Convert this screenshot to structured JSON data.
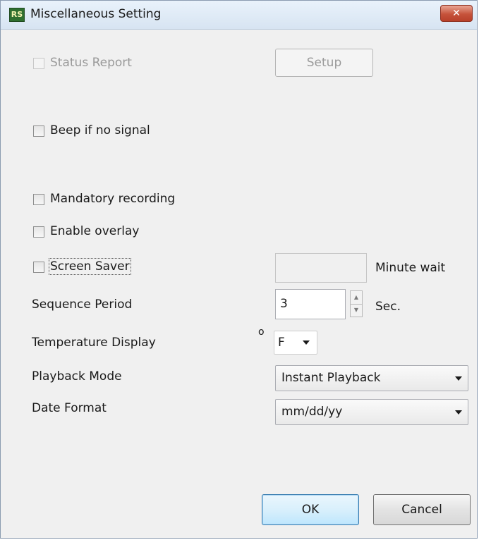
{
  "window": {
    "title": "Miscellaneous Setting",
    "icon": "RS",
    "close_icon": "✕"
  },
  "status_report": {
    "label": "Status Report",
    "checked": false,
    "enabled": false
  },
  "setup_button": {
    "label": "Setup",
    "enabled": false
  },
  "beep_if_no_signal": {
    "label": "Beep if no signal",
    "checked": false
  },
  "mandatory_recording": {
    "label": "Mandatory recording",
    "checked": false
  },
  "enable_overlay": {
    "label": "Enable overlay",
    "checked": false
  },
  "screen_saver": {
    "label": "Screen Saver",
    "checked": false,
    "value": "",
    "unit": "Minute wait"
  },
  "sequence_period": {
    "label": "Sequence Period",
    "value": "3",
    "unit": "Sec.",
    "up_arrow": "▲",
    "down_arrow": "▼"
  },
  "temperature_display": {
    "label": "Temperature Display",
    "degree_symbol": "o",
    "selected": "F"
  },
  "playback_mode": {
    "label": "Playback Mode",
    "selected": "Instant Playback"
  },
  "date_format": {
    "label": "Date Format",
    "selected": "mm/dd/yy"
  },
  "buttons": {
    "ok": "OK",
    "cancel": "Cancel"
  }
}
